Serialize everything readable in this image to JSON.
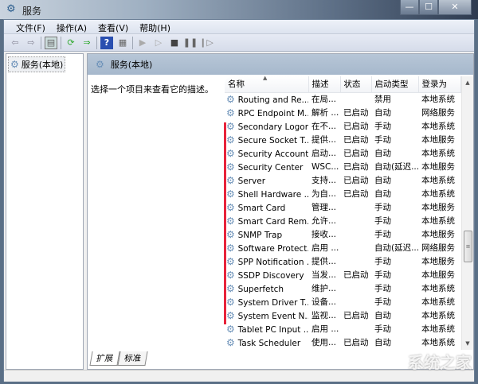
{
  "window": {
    "title": "服务",
    "minimize": "—",
    "maximize": "☐",
    "close": "✕"
  },
  "menu": [
    "文件(F)",
    "操作(A)",
    "查看(V)",
    "帮助(H)"
  ],
  "toolbar": [
    "back",
    "forward",
    "show-hide-console-tree",
    "refresh",
    "export-list",
    "help",
    "properties",
    "start",
    "start-alt",
    "stop",
    "pause",
    "resume"
  ],
  "tree": {
    "item": "服务(本地)"
  },
  "panel": {
    "title": "服务(本地)",
    "description": "选择一个项目来查看它的描述。"
  },
  "columns": [
    "名称",
    "描述",
    "状态",
    "启动类型",
    "登录为"
  ],
  "rows": [
    [
      "Routing and Re...",
      "在局...",
      "",
      "禁用",
      "本地系统"
    ],
    [
      "RPC Endpoint M...",
      "解析 ...",
      "已启动",
      "自动",
      "网络服务"
    ],
    [
      "Secondary Logon",
      "在不...",
      "已启动",
      "手动",
      "本地系统"
    ],
    [
      "Secure Socket T...",
      "提供...",
      "已启动",
      "手动",
      "本地服务"
    ],
    [
      "Security Account...",
      "启动...",
      "已启动",
      "自动",
      "本地系统"
    ],
    [
      "Security Center",
      "WSC...",
      "已启动",
      "自动(延迟...",
      "本地服务"
    ],
    [
      "Server",
      "支持...",
      "已启动",
      "自动",
      "本地系统"
    ],
    [
      "Shell Hardware ...",
      "为自...",
      "已启动",
      "自动",
      "本地系统"
    ],
    [
      "Smart Card",
      "管理...",
      "",
      "手动",
      "本地服务"
    ],
    [
      "Smart Card Rem...",
      "允许...",
      "",
      "手动",
      "本地系统"
    ],
    [
      "SNMP Trap",
      "接收...",
      "",
      "手动",
      "本地服务"
    ],
    [
      "Software Protect...",
      "启用 ...",
      "",
      "自动(延迟...",
      "网络服务"
    ],
    [
      "SPP Notification ...",
      "提供...",
      "",
      "手动",
      "本地服务"
    ],
    [
      "SSDP Discovery",
      "当发...",
      "已启动",
      "手动",
      "本地服务"
    ],
    [
      "Superfetch",
      "维护...",
      "",
      "手动",
      "本地系统"
    ],
    [
      "System Driver T...",
      "设备...",
      "",
      "手动",
      "本地系统"
    ],
    [
      "System Event N...",
      "监视...",
      "已启动",
      "自动",
      "本地系统"
    ],
    [
      "Tablet PC Input ...",
      "启用 ...",
      "",
      "手动",
      "本地系统"
    ],
    [
      "Task Scheduler",
      "使用...",
      "已启动",
      "自动",
      "本地系统"
    ]
  ],
  "tabs": [
    "扩展",
    "标准"
  ],
  "watermark": "系统之家",
  "colors": {
    "highlight": "#e8233a",
    "header": "#a6b8cc"
  }
}
